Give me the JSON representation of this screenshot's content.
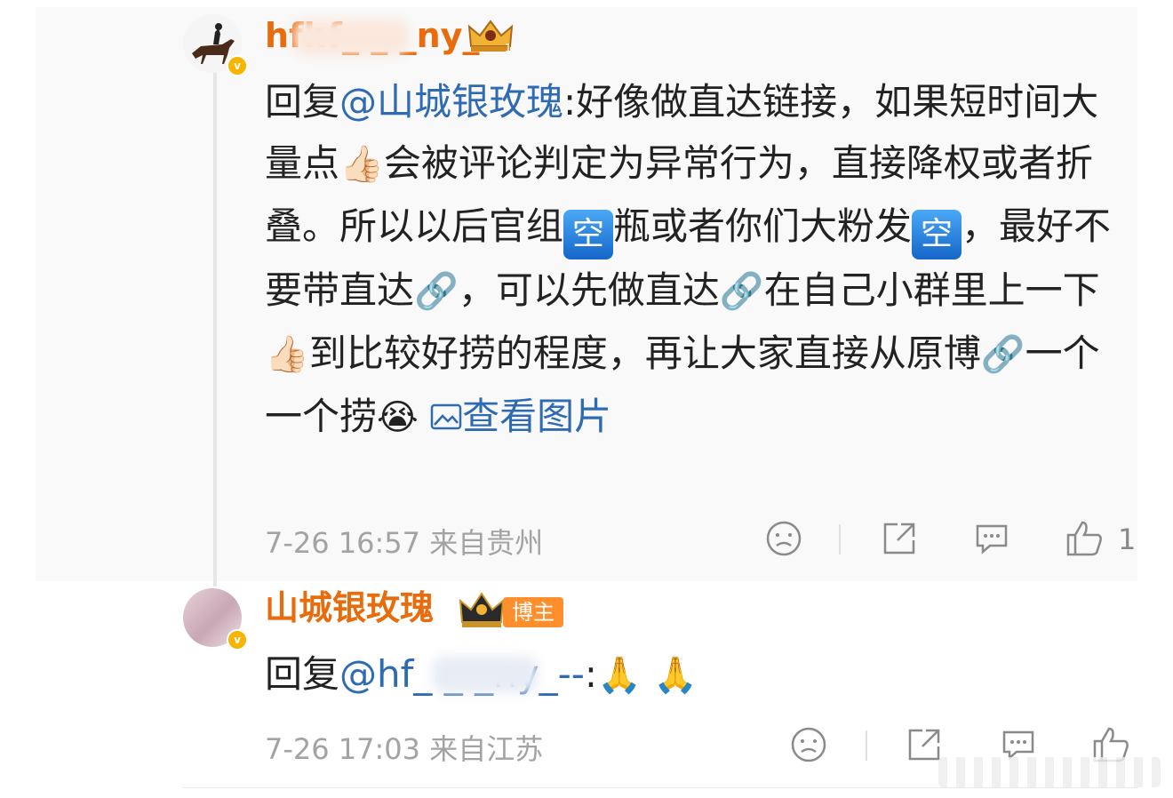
{
  "comment1": {
    "username": "hfhf_ _ _ny_--",
    "reply_prefix": "回复",
    "mention": "@山城银玫瑰",
    "segments": {
      "s1": ":好像做直达链接，如果短时间大量点",
      "s2": "会被评论判定为异常行为，直接降权或者折叠。所以以后官组",
      "s3": "瓶或者你们大粉发",
      "s4": "，最好不要带直达",
      "s5": "，可以先做直达",
      "s6": "在自己小群里上一下",
      "s7": "到比较好捞的程度，再让大家直接从原博",
      "s8": "一个一个捞"
    },
    "kong_badge": "空",
    "view_image": "查看图片",
    "meta": "7-26 16:57  来自贵州",
    "like_count": "1"
  },
  "comment2": {
    "username": "山城银玫瑰",
    "host_tag": "博主",
    "reply_prefix": "回复",
    "mention": "@hf_ _ _ny_--",
    "suffix": ":",
    "meta": "7-26 17:03  来自江苏"
  },
  "icons": {
    "thumbs": "👍🏻",
    "link": "🔗",
    "cry": "😭",
    "pray": "🙏"
  },
  "colors": {
    "username": "#e86b0c",
    "mention": "#2e6bb3",
    "meta": "#a3a3a3"
  }
}
